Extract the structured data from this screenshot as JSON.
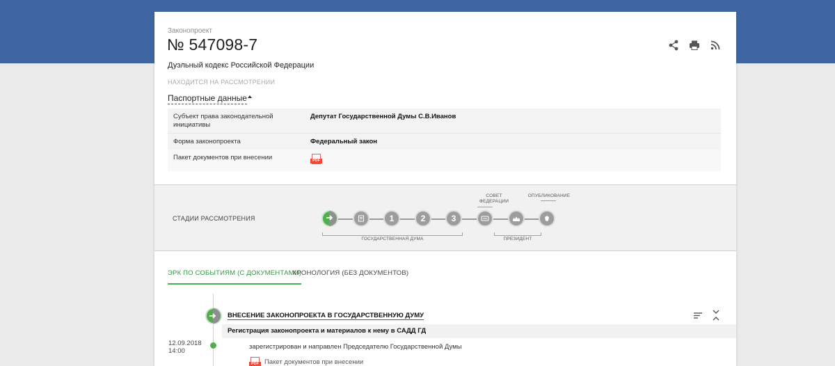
{
  "bill": {
    "kicker": "Законопроект",
    "number": "№ 547098-7",
    "name": "Дуэльный кодекс Российской Федерации",
    "status": "НАХОДИТСЯ НА РАССМОТРЕНИИ"
  },
  "passport": {
    "toggle_label": "Паспортные данные",
    "rows": [
      {
        "key": "Субъект права законодательной инициативы",
        "value": "Депутат Государственной Думы С.В.Иванов"
      },
      {
        "key": "Форма законопроекта",
        "value": "Федеральный закон"
      },
      {
        "key": "Пакет документов при внесении",
        "value": ""
      }
    ]
  },
  "stages": {
    "label": "СТАДИИ РАССМОТРЕНИЯ",
    "items": [
      {
        "name": "introduction",
        "glyph": "",
        "active": true
      },
      {
        "name": "preliminary",
        "glyph": "",
        "active": false
      },
      {
        "name": "reading-1",
        "glyph": "1",
        "active": false
      },
      {
        "name": "reading-2",
        "glyph": "2",
        "active": false
      },
      {
        "name": "reading-3",
        "glyph": "3",
        "active": false
      },
      {
        "name": "federation-council",
        "glyph": "",
        "active": false
      },
      {
        "name": "president",
        "glyph": "",
        "active": false
      },
      {
        "name": "publication",
        "glyph": "",
        "active": false
      }
    ],
    "group_duma": "ГОСУДАРСТВЕННАЯ ДУМА",
    "group_council": "СОВЕТ ФЕДЕРАЦИИ",
    "group_president": "ПРЕЗИДЕНТ",
    "group_publication": "ОПУБЛИКОВАНИЕ"
  },
  "tabs": [
    {
      "label": "ЭРК ПО СОБЫТИЯМ (С ДОКУМЕНТАМИ)",
      "active": true
    },
    {
      "label": "ХРОНОЛОГИЯ (БЕЗ ДОКУМЕНТОВ)",
      "active": false
    }
  ],
  "timeline": {
    "event_title": "ВНЕСЕНИЕ ЗАКОНОПРОЕКТА В ГОСУДАРСТВЕННУЮ ДУМУ",
    "event_subtitle": "Регистрация законопроекта и материалов к нему в САДД ГД",
    "date": "12.09.2018",
    "time": "14:00",
    "description": "зарегистрирован и направлен Председателю Государственной Думы",
    "document_link": "Пакет документов при внесении"
  },
  "icons": {
    "pdf_label": "PDF"
  },
  "colors": {
    "header_band": "#3e65a2",
    "accent_green": "#4caf50",
    "stage_grey": "#9d9d9d",
    "pdf_red": "#e84b3c"
  }
}
